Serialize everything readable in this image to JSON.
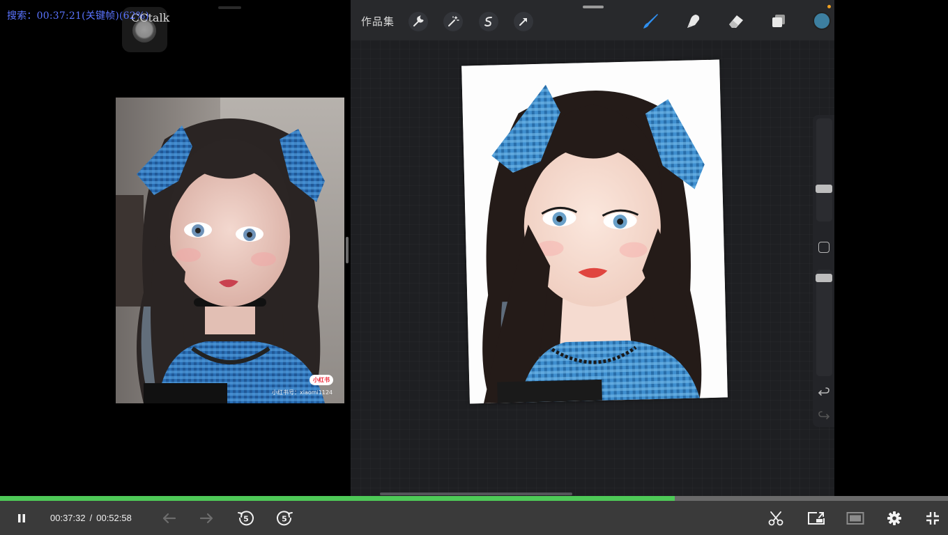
{
  "overlay": {
    "search_text": "搜索：00:37:21(关键帧)(62%)"
  },
  "floating_app": {
    "label": "CCtalk"
  },
  "reference_photo": {
    "watermark_logo": "小红书",
    "watermark_text": "小红书号：xiaomi1124"
  },
  "procreate": {
    "gallery_label": "作品集",
    "tools_left": [
      "wrench-icon",
      "magic-wand-icon",
      "selection-icon",
      "transform-arrow-icon"
    ],
    "tools_right": [
      "brush-icon",
      "smudge-icon",
      "eraser-icon",
      "layers-icon"
    ],
    "current_color": "#3d7fa0"
  },
  "player": {
    "current_time": "00:37:32",
    "separator": "/",
    "total_time": "00:52:58",
    "progress": 0.712,
    "accent": "#4ec957",
    "controls": [
      "pause-icon",
      "prev-icon",
      "next-icon",
      "rewind-5-icon",
      "forward-5-icon",
      "clip-icon",
      "pip-icon",
      "window-icon",
      "settings-icon",
      "exit-fullscreen-icon"
    ],
    "skip_seconds": "5"
  }
}
